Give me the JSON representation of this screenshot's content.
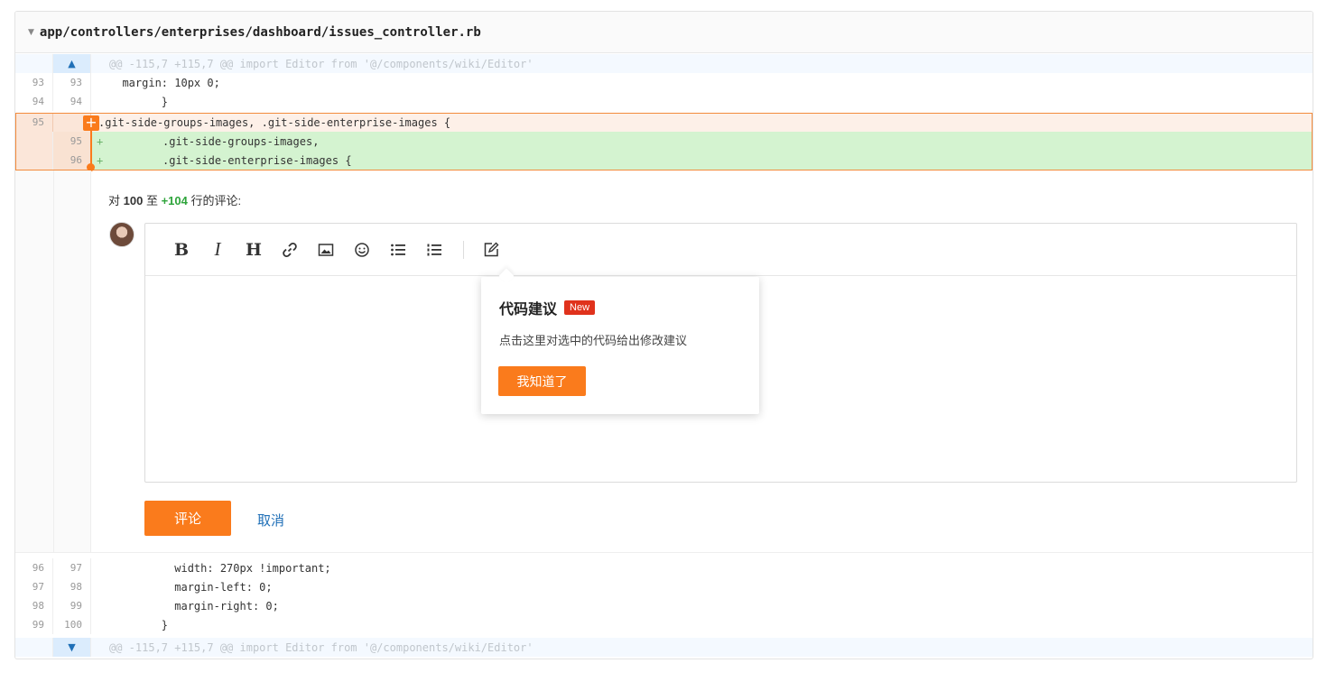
{
  "file": {
    "path": "app/controllers/enterprises/dashboard/issues_controller.rb"
  },
  "hunk_top": {
    "text": "@@ -115,7 +115,7 @@ import Editor from '@/components/wiki/Editor'"
  },
  "hunk_bottom": {
    "text": "@@ -115,7 +115,7 @@ import Editor from '@/components/wiki/Editor'"
  },
  "lines_top": [
    {
      "old": "93",
      "new": "93",
      "code": "  margin: 10px 0;"
    },
    {
      "old": "94",
      "new": "94",
      "code": "        }"
    }
  ],
  "selected": [
    {
      "old": "95",
      "new": "",
      "code": ".git-side-groups-images, .git-side-enterprise-images {"
    },
    {
      "old": "",
      "new": "95",
      "sign": "+",
      "code": "        .git-side-groups-images,"
    },
    {
      "old": "",
      "new": "96",
      "sign": "+",
      "code": "        .git-side-enterprise-images {"
    }
  ],
  "lines_bottom": [
    {
      "old": "96",
      "new": "97",
      "code": "          width: 270px !important;"
    },
    {
      "old": "97",
      "new": "98",
      "code": "          margin-left: 0;"
    },
    {
      "old": "98",
      "new": "99",
      "code": "          margin-right: 0;"
    },
    {
      "old": "99",
      "new": "100",
      "code": "        }"
    }
  ],
  "comment": {
    "range_prefix": "对 ",
    "range_from": "100",
    "range_mid": " 至 ",
    "range_to": "+104",
    "range_suffix": " 行的评论:",
    "submit_label": "评论",
    "cancel_label": "取消"
  },
  "toolbar": {
    "bold": "B",
    "italic": "I",
    "heading": "H"
  },
  "popover": {
    "title": "代码建议",
    "badge": "New",
    "description": "点击这里对选中的代码给出修改建议",
    "button": "我知道了"
  },
  "colors": {
    "accent": "#fa7b1c",
    "added_bg": "#d4f3d0",
    "link": "#1f6fb7",
    "badge": "#e0321c"
  }
}
